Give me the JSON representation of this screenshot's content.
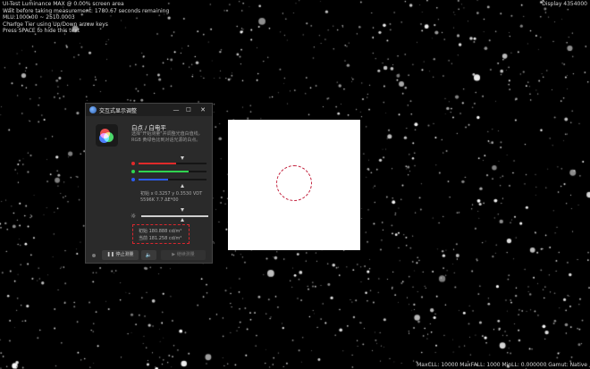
{
  "hud": {
    "lines": [
      "UI-Test Luminance MAX @ 0.00% screen area",
      "Wait before taking measurement: 1780.67 seconds remaining",
      "MLU:1000.00  ~ 2510.0003",
      "  Change Tier using Up/Down arrow keys",
      "Press SPACE to hide this text"
    ],
    "top_right": "Display 4354000",
    "bottom_right": "MaxCLL: 10000  MaxFALL: 1000  MinLL: 0.000000  Gamut: Native"
  },
  "window": {
    "title": "交互式显示调整",
    "controls": {
      "minimize": "—",
      "maximize": "□",
      "close": "✕"
    },
    "section_title": "白点 / 白电平",
    "description": "选择\"开始测量\"并调整光值白值线，RGB 黄绿色比到对话光源的白点。",
    "channels": [
      {
        "name": "red",
        "color": "#e02a2a",
        "level": 0.55
      },
      {
        "name": "green",
        "color": "#2fd44f",
        "level": 0.74
      },
      {
        "name": "blue",
        "color": "#2c5cf0",
        "level": 0.43
      }
    ],
    "coords_line1": "初始 x 0.3257 y 0.3530 VDT",
    "coords_line2": "5596K 7.7 ΔE*00",
    "luminance_initial": "初始 180.888 cd/m²",
    "luminance_current": "当前 181.258 cd/m²",
    "buttons": {
      "pause": "停止测量",
      "settings": "▶  继续测量"
    }
  }
}
